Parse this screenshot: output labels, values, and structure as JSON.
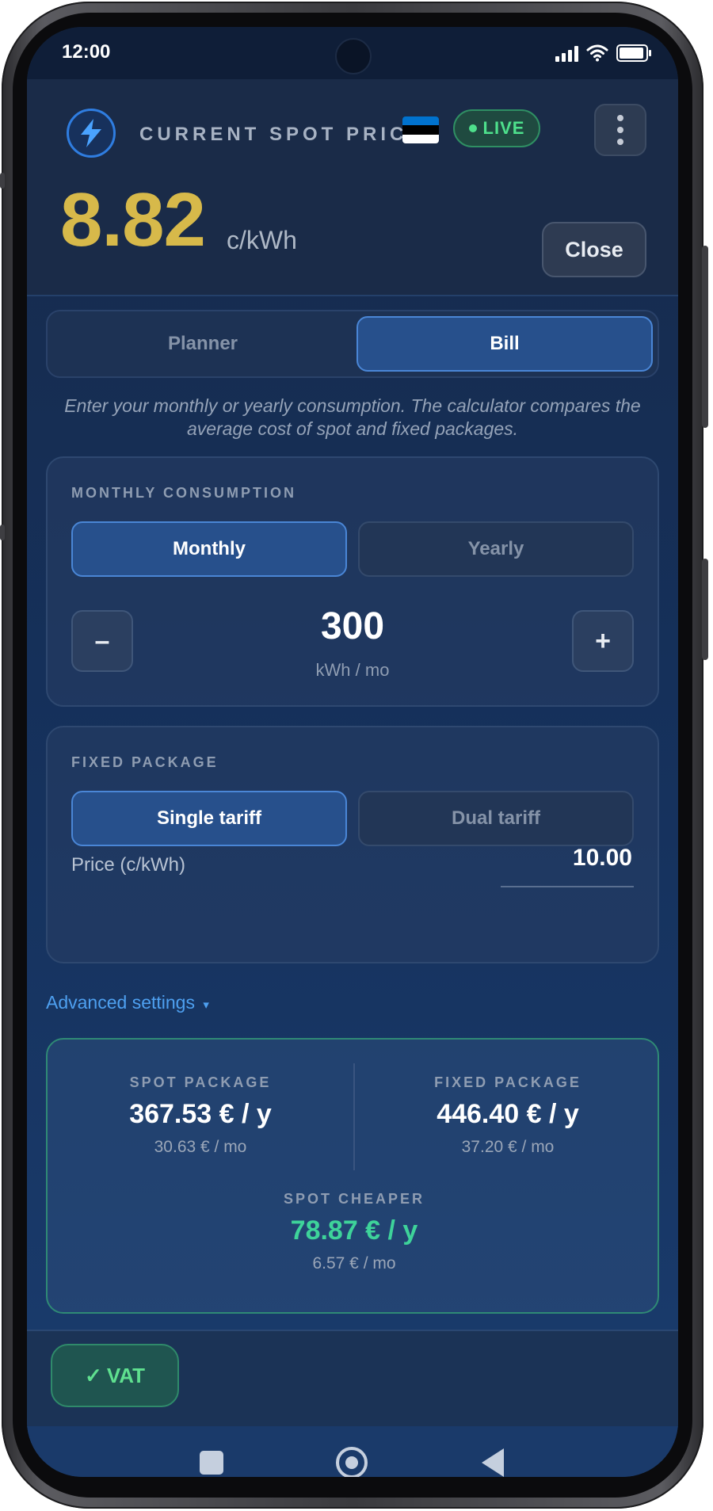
{
  "status_bar": {
    "time": "12:00"
  },
  "header": {
    "title": "CURRENT SPOT PRICE",
    "live_label": "LIVE",
    "price_value": "8.82",
    "price_unit": "c/kWh",
    "close_label": "Close",
    "price_color": "#d7b94a",
    "flag_colors": [
      "#0072ce",
      "#000000",
      "#ffffff"
    ]
  },
  "mode_tabs": [
    {
      "label": "Planner",
      "active": false
    },
    {
      "label": "Bill",
      "active": true
    }
  ],
  "description": "Enter your monthly or yearly consumption. The calculator compares the average cost of spot and fixed packages.",
  "consumption": {
    "label": "MONTHLY CONSUMPTION",
    "period_options": [
      {
        "label": "Monthly",
        "active": true
      },
      {
        "label": "Yearly",
        "active": false
      }
    ],
    "decrement_label": "–",
    "increment_label": "+",
    "value": "300",
    "unit": "kWh / mo"
  },
  "fixed_package": {
    "label": "FIXED PACKAGE",
    "tariff_options": [
      {
        "label": "Single tariff",
        "active": true
      },
      {
        "label": "Dual tariff",
        "active": false
      }
    ],
    "price_label": "Price (c/kWh)",
    "price_value": "10.00"
  },
  "advanced_settings": {
    "label": "Advanced settings",
    "chevron": "▾"
  },
  "results": {
    "spot": {
      "label": "SPOT PACKAGE",
      "yearly": "367.53 € / y",
      "monthly": "30.63 € / mo"
    },
    "fixed": {
      "label": "FIXED PACKAGE",
      "yearly": "446.40 € / y",
      "monthly": "37.20 € / mo"
    },
    "cheaper": {
      "label": "SPOT CHEAPER",
      "yearly": "78.87 € / y",
      "monthly": "6.57 € / mo",
      "color": "#3ed39a"
    }
  },
  "vat": {
    "check": "✓",
    "label": "VAT"
  },
  "icons": {
    "logo": "lightning-bolt-icon",
    "menu": "kebab-menu-icon",
    "nav_recents": "square-icon",
    "nav_home": "circle-icon",
    "nav_back": "triangle-back-icon"
  }
}
